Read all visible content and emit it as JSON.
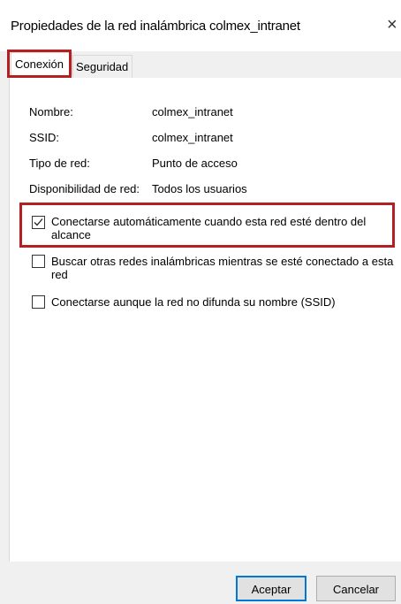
{
  "window": {
    "title": "Propiedades de la red inalámbrica colmex_intranet",
    "close_glyph": "×"
  },
  "tabs": [
    {
      "label": "Conexión",
      "active": true
    },
    {
      "label": "Seguridad",
      "active": false
    }
  ],
  "properties": [
    {
      "label": "Nombre:",
      "value": "colmex_intranet"
    },
    {
      "label": "SSID:",
      "value": "colmex_intranet"
    },
    {
      "label": "Tipo de red:",
      "value": "Punto de acceso"
    },
    {
      "label": "Disponibilidad de red:",
      "value": "Todos los usuarios"
    }
  ],
  "options": [
    {
      "label": "Conectarse automáticamente cuando esta red esté dentro del alcance",
      "checked": true
    },
    {
      "label": "Buscar otras redes inalámbricas mientras se esté conectado a esta red",
      "checked": false
    },
    {
      "label": "Conectarse aunque la red no difunda su nombre (SSID)",
      "checked": false
    }
  ],
  "buttons": {
    "ok_label": "Aceptar",
    "cancel_label": "Cancelar"
  },
  "colors": {
    "highlight": "#b41f23",
    "default_button_border": "#0078d7"
  },
  "icons": {
    "close": "close-icon",
    "check": "checkmark-icon"
  }
}
